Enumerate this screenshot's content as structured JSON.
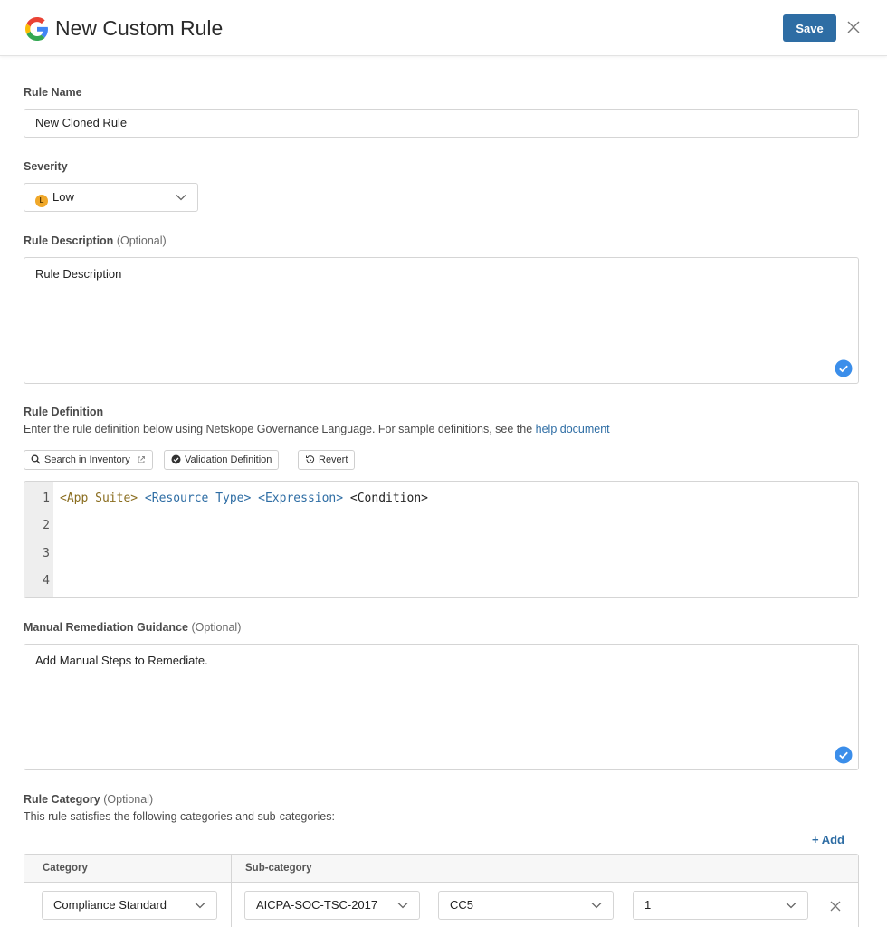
{
  "header": {
    "title": "New Custom Rule",
    "save_label": "Save"
  },
  "rule_name": {
    "label": "Rule Name",
    "value": "New Cloned Rule"
  },
  "severity": {
    "label": "Severity",
    "badge_letter": "L",
    "value": "Low"
  },
  "rule_description": {
    "label": "Rule Description",
    "optional": "(Optional)",
    "value": "Rule Description"
  },
  "rule_definition": {
    "label": "Rule Definition",
    "help_text": "Enter the rule definition below using Netskope Governance Language. For sample definitions, see the",
    "help_link": "help document",
    "tools": {
      "search": "Search in Inventory",
      "validate": "Validation Definition",
      "revert": "Revert"
    },
    "line_numbers": [
      "1",
      "2",
      "3",
      "4"
    ],
    "tokens": {
      "app": "<App Suite>",
      "resource": "<Resource Type>",
      "expression": "<Expression>",
      "condition": "<Condition>"
    }
  },
  "remediation": {
    "label": "Manual Remediation Guidance",
    "optional": "(Optional)",
    "value": "Add Manual Steps to Remediate."
  },
  "rule_category": {
    "label": "Rule Category",
    "optional": "(Optional)",
    "help_text": "This rule satisfies the following categories and sub-categories:",
    "add_label": "+ Add",
    "columns": {
      "category": "Category",
      "subcategory": "Sub-category"
    },
    "row": {
      "category": "Compliance Standard",
      "standard": "AICPA-SOC-TSC-2017",
      "section": "CC5",
      "item": "1"
    }
  },
  "colors": {
    "accent": "#2e6da4",
    "severity_low": "#f0a82a",
    "check": "#3b8eea"
  },
  "icons": [
    "google-logo-icon",
    "close-icon",
    "chevron-down-icon",
    "search-icon",
    "external-link-icon",
    "check-circle-icon",
    "history-icon"
  ]
}
